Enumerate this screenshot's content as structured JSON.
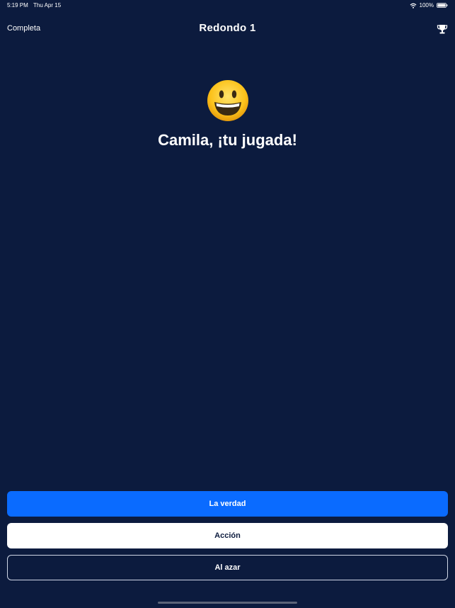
{
  "status_bar": {
    "time": "5:19 PM",
    "date": "Thu Apr 15",
    "battery": "100%"
  },
  "nav": {
    "left_label": "Completa",
    "title": "Redondo 1",
    "right_icon": "trophy-icon"
  },
  "main": {
    "emoji_icon": "grinning-face-icon",
    "prompt": "Camila, ¡tu jugada!"
  },
  "actions": {
    "truth_label": "La verdad",
    "dare_label": "Acción",
    "random_label": "Al azar"
  },
  "colors": {
    "background": "#0c1b3e",
    "primary": "#0a6bff",
    "secondary": "#ffffff"
  }
}
